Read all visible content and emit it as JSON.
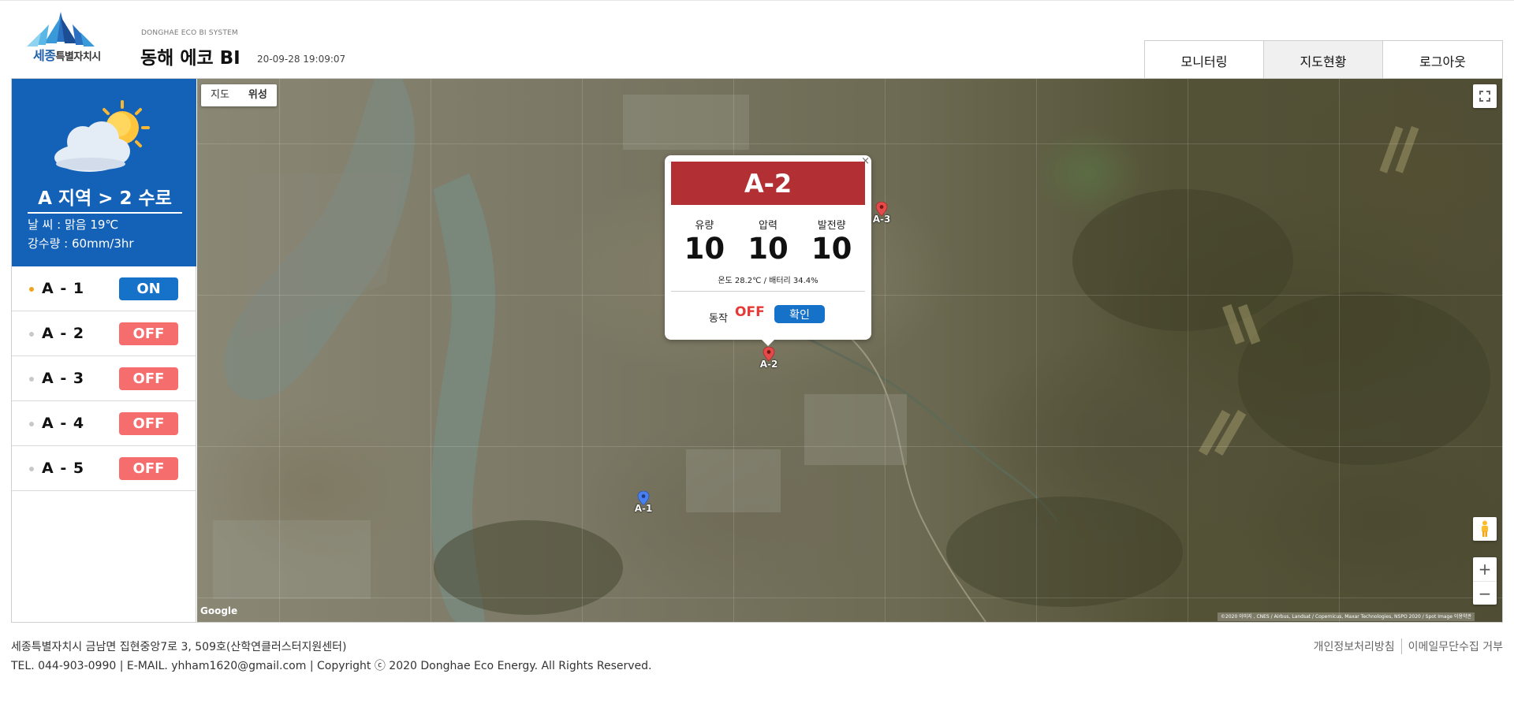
{
  "header": {
    "logo_text": "세종",
    "logo_subtext": "특별자치시",
    "subtitle": "DONGHAE ECO BI SYSTEM",
    "title": "동해 에코 BI",
    "datetime": "20-09-28 19:09:07"
  },
  "nav": [
    {
      "label": "모니터링",
      "active": false
    },
    {
      "label": "지도현황",
      "active": true
    },
    {
      "label": "로그아웃",
      "active": false
    }
  ],
  "weather": {
    "icon": "partly-cloudy-icon",
    "region": "A 지역 > 2 수로",
    "line1": "날    씨 : 맑음 19℃",
    "line2": "강수량 : 60mm/3hr"
  },
  "stations": [
    {
      "name": "A - 1",
      "state": "ON"
    },
    {
      "name": "A - 2",
      "state": "OFF"
    },
    {
      "name": "A - 3",
      "state": "OFF"
    },
    {
      "name": "A - 4",
      "state": "OFF"
    },
    {
      "name": "A - 5",
      "state": "OFF"
    }
  ],
  "map": {
    "type_buttons": [
      "지도",
      "위성"
    ],
    "google": "Google",
    "attribution": "©2020 이미지 , CNES / Airbus, Landsat / Copernicus, Maxar Technologies, NSPO 2020 / Spot Image  이용약관",
    "markers": [
      {
        "label": "A-1",
        "color": "#4a7ff0"
      },
      {
        "label": "A-2",
        "color": "#e34b4b"
      },
      {
        "label": "A-3",
        "color": "#e34b4b"
      }
    ]
  },
  "popup": {
    "close": "×",
    "title": "A-2",
    "metrics": [
      {
        "label": "유량",
        "value": "10"
      },
      {
        "label": "압력",
        "value": "10"
      },
      {
        "label": "발전량",
        "value": "10"
      }
    ],
    "sub": "온도 28.2℃ / 배터리 34.4%",
    "op_label": "동작",
    "op_state": "OFF",
    "confirm": "확인"
  },
  "footer": {
    "address": "세종특별자치시 금남면 집현중앙7로 3, 509호(산학연클러스터지원센터)",
    "copyright": "TEL. 044-903-0990 | E-MAIL. yhham1620@gmail.com | Copyright ⓒ 2020 Donghae Eco Energy. All Rights Reserved.",
    "links": [
      "개인정보처리방침",
      "이메일무단수집 거부"
    ]
  }
}
